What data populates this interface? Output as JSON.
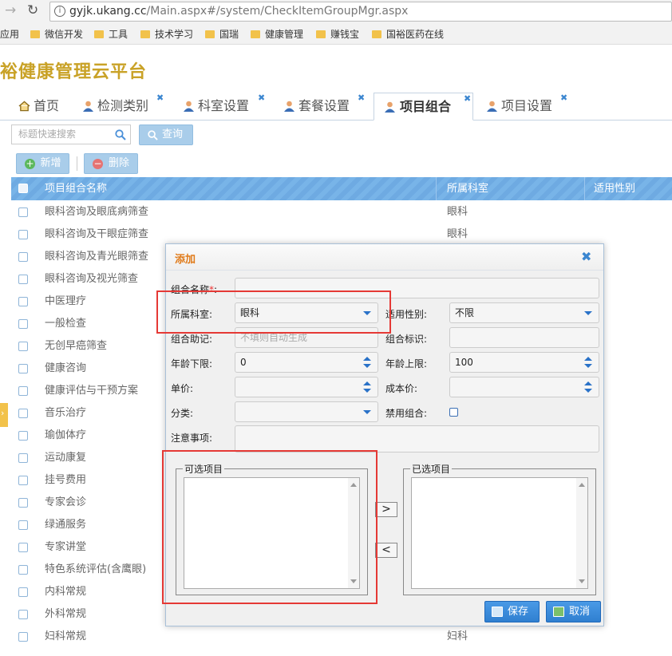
{
  "browser": {
    "url_host": "gyjk.ukang.cc",
    "url_path": "/Main.aspx#/system/CheckItemGroupMgr.aspx",
    "bookmarks": [
      "应用",
      "微信开发",
      "工具",
      "技术学习",
      "国瑞",
      "健康管理",
      "赚钱宝",
      "国裕医药在线"
    ]
  },
  "app": {
    "title": "裕健康管理云平台"
  },
  "tabs": [
    {
      "label": "首页",
      "icon": "home-icon"
    },
    {
      "label": "检测类别",
      "icon": "user-icon"
    },
    {
      "label": "科室设置",
      "icon": "user-icon"
    },
    {
      "label": "套餐设置",
      "icon": "user-icon"
    },
    {
      "label": "项目组合",
      "icon": "user-icon",
      "active": true
    },
    {
      "label": "项目设置",
      "icon": "user-icon"
    }
  ],
  "toolbar": {
    "search_placeholder": "标题快速搜索",
    "query_label": "查询",
    "add_label": "新增",
    "delete_label": "删除"
  },
  "list": {
    "columns": [
      "项目组合名称",
      "所属科室",
      "适用性别"
    ],
    "rows": [
      {
        "name": "眼科咨询及眼底病筛查",
        "dept": "眼科"
      },
      {
        "name": "眼科咨询及干眼症筛查",
        "dept": "眼科"
      },
      {
        "name": "眼科咨询及青光眼筛查",
        "dept": ""
      },
      {
        "name": "眼科咨询及视光筛查",
        "dept": ""
      },
      {
        "name": "中医理疗",
        "dept": ""
      },
      {
        "name": "一般检查",
        "dept": ""
      },
      {
        "name": "无创早癌筛查",
        "dept": ""
      },
      {
        "name": "健康咨询",
        "dept": ""
      },
      {
        "name": "健康评估与干预方案",
        "dept": ""
      },
      {
        "name": "音乐治疗",
        "dept": ""
      },
      {
        "name": "瑜伽体疗",
        "dept": ""
      },
      {
        "name": "运动康复",
        "dept": ""
      },
      {
        "name": "挂号费用",
        "dept": ""
      },
      {
        "name": "专家会诊",
        "dept": ""
      },
      {
        "name": "绿通服务",
        "dept": ""
      },
      {
        "name": "专家讲堂",
        "dept": ""
      },
      {
        "name": "特色系统评估(含鹰眼)",
        "dept": ""
      },
      {
        "name": "内科常规",
        "dept": ""
      },
      {
        "name": "外科常规",
        "dept": ""
      },
      {
        "name": "妇科常规",
        "dept": "妇科"
      }
    ]
  },
  "dialog": {
    "title": "添加",
    "fields": {
      "group_name_label": "组合名称",
      "required_mark": "*",
      "colon": ":",
      "dept_label": "所属科室:",
      "dept_value": "眼科",
      "gender_label": "适用性别:",
      "gender_value": "不限",
      "mnemonic_label": "组合助记:",
      "mnemonic_placeholder": "不填则自动生成",
      "flag_label": "组合标识:",
      "age_min_label": "年龄下限:",
      "age_min_value": "0",
      "age_max_label": "年龄上限:",
      "age_max_value": "100",
      "price_label": "单价:",
      "cost_label": "成本价:",
      "category_label": "分类:",
      "disabled_label": "禁用组合:",
      "notes_label": "注意事项:"
    },
    "available_label": "可选项目",
    "selected_label": "已选项目",
    "move_right": ">",
    "move_left": "<",
    "save_label": "保存",
    "cancel_label": "取消"
  }
}
